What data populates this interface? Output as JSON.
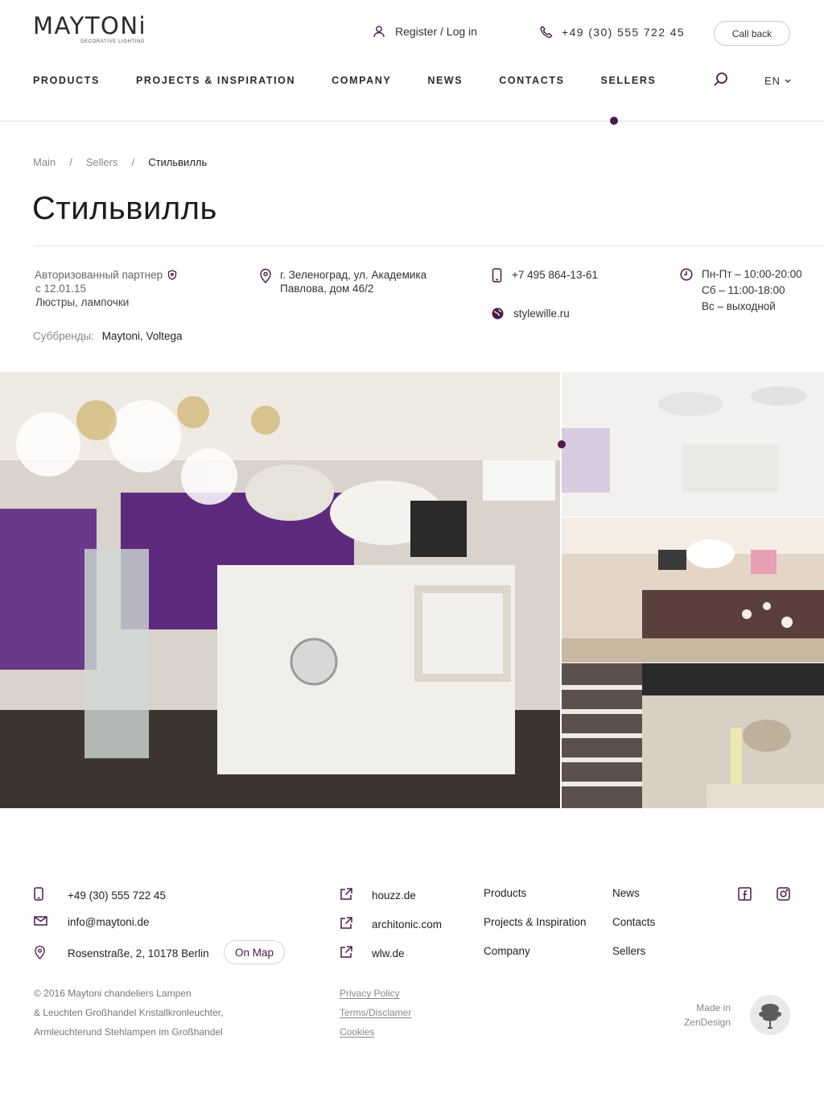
{
  "brand": {
    "name": "MAYTONi",
    "tagline": "DECORATIVE LIGHTING"
  },
  "header": {
    "auth_label": "Register / Log in",
    "phone": "+49 (30) 555 722 45",
    "callback_label": "Call back",
    "language": "EN"
  },
  "nav": {
    "items": [
      "PRODUCTS",
      "PROJECTS & INSPIRATION",
      "COMPANY",
      "NEWS",
      "CONTACTS",
      "SELLERS"
    ],
    "active": "SELLERS"
  },
  "breadcrumb": [
    "Main",
    "Sellers",
    "Стильвилль"
  ],
  "page_title": "Стильвилль",
  "seller": {
    "partner_status": "Авторизованный партнер",
    "partner_since": "с 12.01.15",
    "category": "Люстры, лампочки",
    "subbrands_label": "Суббренды:",
    "subbrands": "Maytoni, Voltega",
    "address_line1": "г. Зеленоград, ул. Академика",
    "address_line2": "Павлова, дом 46/2",
    "phone": "+7 495 864-13-61",
    "website": "stylewille.ru",
    "hours": [
      "Пн-Пт – 10:00-20:00",
      "Сб – 11:00-18:00",
      "Вс – выходной"
    ]
  },
  "footer": {
    "contacts": {
      "phone": "+49 (30) 555 722 45",
      "email": "info@maytoni.de",
      "address": "Rosenstraße, 2, 10178 Berlin",
      "map_label": "On Map"
    },
    "external_links": [
      "houzz.de",
      "architonic.com",
      "wlw.de"
    ],
    "menu_col1": [
      "Products",
      "Projects & Inspiration",
      "Company"
    ],
    "menu_col2": [
      "News",
      "Contacts",
      "Sellers"
    ],
    "copyright": [
      "© 2016 Maytoni chandeliers Lampen",
      "& Leuchten Großhandel Kristallkronleuchter,",
      "Armleuchterund Stehlampen im Großhandel"
    ],
    "legal": [
      "Privacy Policy",
      "Terms/Disclamer",
      "Cookies"
    ],
    "made_in": [
      "Made in",
      "ZenDesign"
    ]
  },
  "colors": {
    "accent": "#4a1a4a",
    "text": "#222222",
    "muted": "#888888",
    "divider": "#e2e2e2"
  }
}
